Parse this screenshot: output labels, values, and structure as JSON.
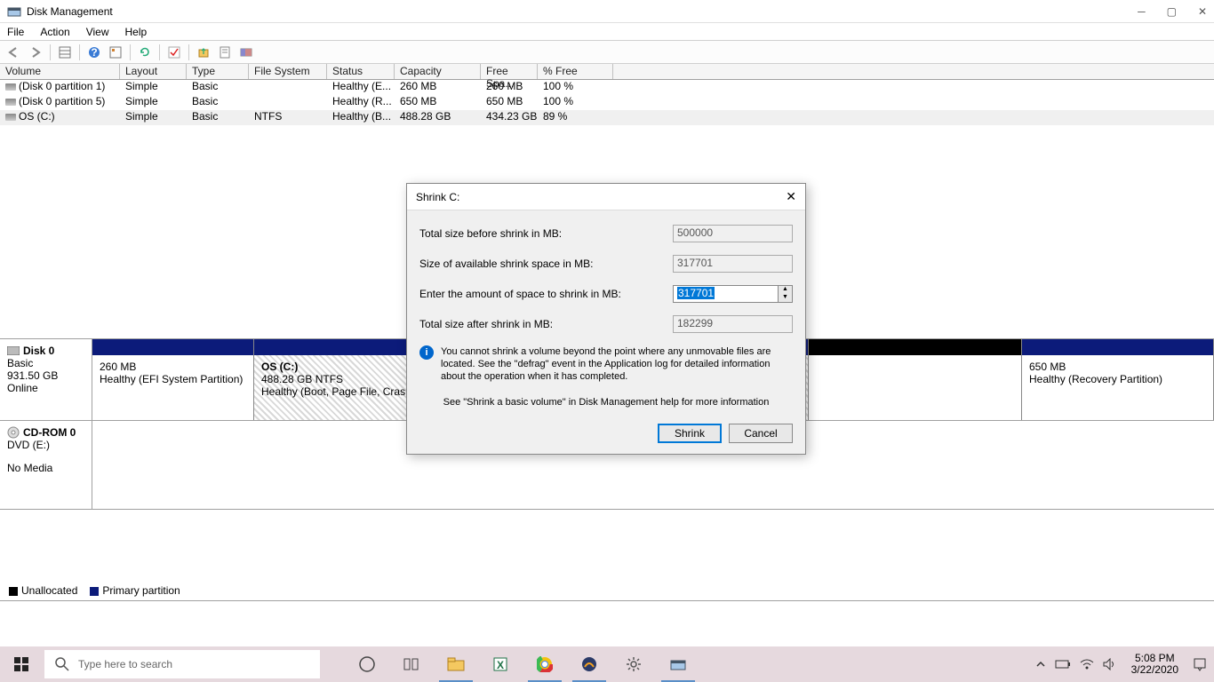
{
  "window": {
    "title": "Disk Management"
  },
  "menu": {
    "file": "File",
    "action": "Action",
    "view": "View",
    "help": "Help"
  },
  "columns": {
    "volume": "Volume",
    "layout": "Layout",
    "type": "Type",
    "fs": "File System",
    "status": "Status",
    "capacity": "Capacity",
    "free": "Free Spa...",
    "pct": "% Free"
  },
  "volumes": [
    {
      "name": "(Disk 0 partition 1)",
      "layout": "Simple",
      "type": "Basic",
      "fs": "",
      "status": "Healthy (E...",
      "capacity": "260 MB",
      "free": "260 MB",
      "pct": "100 %"
    },
    {
      "name": "(Disk 0 partition 5)",
      "layout": "Simple",
      "type": "Basic",
      "fs": "",
      "status": "Healthy (R...",
      "capacity": "650 MB",
      "free": "650 MB",
      "pct": "100 %"
    },
    {
      "name": "OS (C:)",
      "layout": "Simple",
      "type": "Basic",
      "fs": "NTFS",
      "status": "Healthy (B...",
      "capacity": "488.28 GB",
      "free": "434.23 GB",
      "pct": "89 %"
    }
  ],
  "gview": {
    "disk0": {
      "name": "Disk 0",
      "type": "Basic",
      "size": "931.50 GB",
      "state": "Online",
      "parts": [
        {
          "size": "260 MB",
          "desc": "Healthy (EFI System Partition)"
        },
        {
          "title": "OS  (C:)",
          "size": "488.28 GB NTFS",
          "desc": "Healthy (Boot, Page File, Crash"
        },
        {
          "size": "650 MB",
          "desc": "Healthy (Recovery Partition)"
        }
      ]
    },
    "cdrom": {
      "name": "CD-ROM 0",
      "type": "DVD (E:)",
      "state": "No Media"
    }
  },
  "legend": {
    "unalloc": "Unallocated",
    "primary": "Primary partition"
  },
  "dialog": {
    "title": "Shrink C:",
    "l_total_before": "Total size before shrink in MB:",
    "v_total_before": "500000",
    "l_avail": "Size of available shrink space in MB:",
    "v_avail": "317701",
    "l_enter": "Enter the amount of space to shrink in MB:",
    "v_enter": "317701",
    "l_total_after": "Total size after shrink in MB:",
    "v_total_after": "182299",
    "info": "You cannot shrink a volume beyond the point where any unmovable files are located. See the \"defrag\" event in the Application log for detailed information about the operation when it has completed.",
    "link": "See \"Shrink a basic volume\" in Disk Management help for more information",
    "btn_shrink": "Shrink",
    "btn_cancel": "Cancel"
  },
  "taskbar": {
    "search_ph": "Type here to search",
    "time": "5:08 PM",
    "date": "3/22/2020"
  }
}
